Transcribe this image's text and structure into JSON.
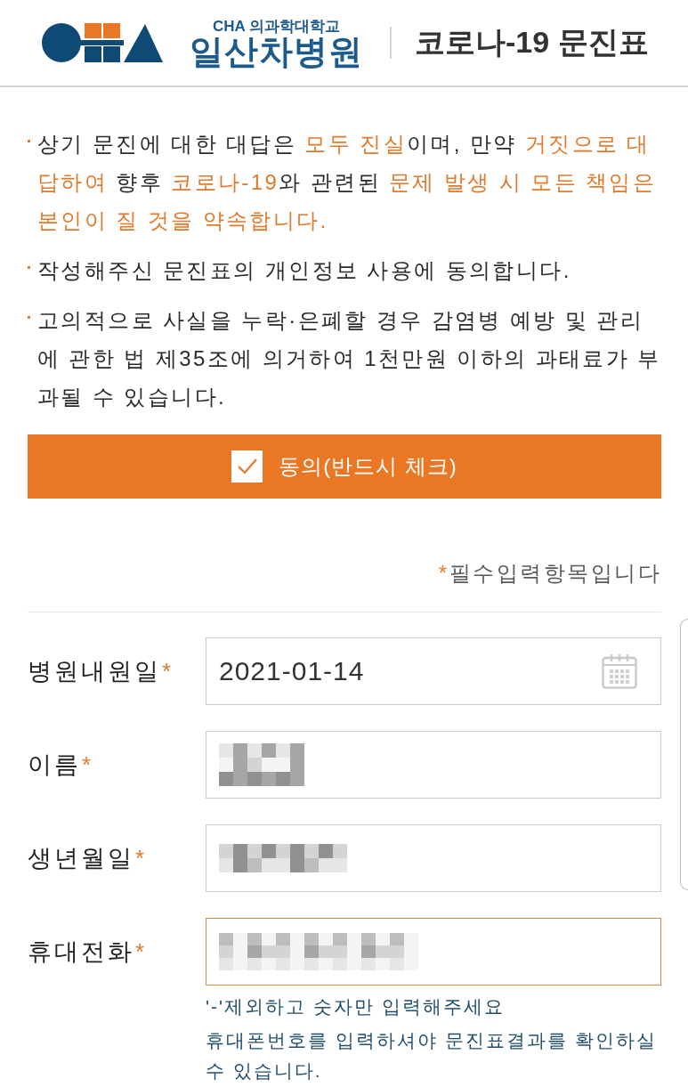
{
  "header": {
    "university_name": "CHA 의과학대학교",
    "hospital_name": "일산차병원",
    "title": "코로나-19 문진표"
  },
  "notices": [
    {
      "segments": [
        {
          "text": "상기 문진에 대한 대답은 ",
          "emphasis": false
        },
        {
          "text": "모두 진실",
          "emphasis": true
        },
        {
          "text": "이며, 만약 ",
          "emphasis": false
        },
        {
          "text": "거짓으로 대답하여",
          "emphasis": true
        },
        {
          "text": " 향후 ",
          "emphasis": false
        },
        {
          "text": "코로나-19",
          "emphasis": true
        },
        {
          "text": "와 관련된 ",
          "emphasis": false
        },
        {
          "text": "문제 발생 시 모든 책임은 본인이 질 것을 약속합니다.",
          "emphasis": true
        }
      ]
    },
    {
      "segments": [
        {
          "text": "작성해주신 문진표의 개인정보 사용에 동의합니다.",
          "emphasis": false
        }
      ]
    },
    {
      "segments": [
        {
          "text": "고의적으로 사실을 누락·은폐할 경우 감염병 예방 및 관리에 관한 법 제35조에 의거하여 1천만원 이하의 과태료가 부과될 수 있습니다.",
          "emphasis": false
        }
      ]
    }
  ],
  "agree_button": {
    "label": "동의(반드시 체크)",
    "checked": true
  },
  "required_note": {
    "mark": "*",
    "text": "필수입력항목입니다"
  },
  "fields": [
    {
      "kind": "date",
      "label": "병원내원일",
      "mark": "*",
      "value": "2021-01-14",
      "redacted": false,
      "focused": false
    },
    {
      "kind": "text",
      "label": "이름",
      "mark": "*",
      "redacted": true,
      "focused": false
    },
    {
      "kind": "text",
      "label": "생년월일",
      "mark": "*",
      "redacted": true,
      "focused": false
    },
    {
      "kind": "text",
      "label": "휴대전화",
      "mark": "*",
      "redacted": true,
      "focused": true,
      "help": [
        "'-'제외하고 숫자만 입력해주세요",
        "휴대폰번호를 입력하셔야 문진표결과를 확인하실 수 있습니다."
      ]
    }
  ]
}
